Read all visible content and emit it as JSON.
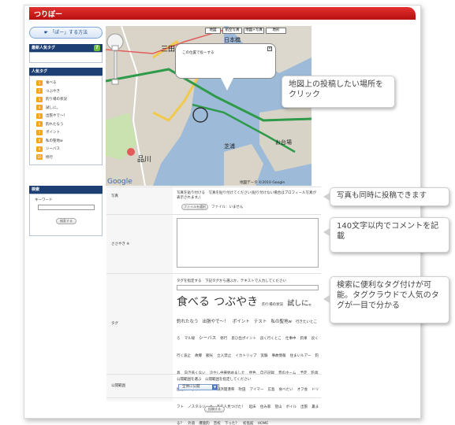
{
  "header": {
    "title": "つりぽー"
  },
  "sidebar": {
    "howto_label": "「ぽー」する方法",
    "popular_fish_title": "最新人気タグ",
    "popular_tags_title": "人気タグ",
    "tags": [
      {
        "num": "1",
        "label": "食べる"
      },
      {
        "num": "2",
        "label": "つぶやき"
      },
      {
        "num": "3",
        "label": "釣り場の状況"
      },
      {
        "num": "4",
        "label": "試しに。"
      },
      {
        "num": "5",
        "label": "出張やで～！"
      },
      {
        "num": "6",
        "label": "釣れたなう"
      },
      {
        "num": "7",
        "label": "ポイント"
      },
      {
        "num": "8",
        "label": "私の聖地w"
      },
      {
        "num": "9",
        "label": "シーバス"
      },
      {
        "num": "10",
        "label": "修行"
      }
    ],
    "search_title": "検索",
    "keyword_label": "キーワード",
    "search_button": "検索する"
  },
  "map": {
    "types": [
      "地図",
      "航空写真",
      "地図+写真",
      "地形"
    ],
    "bubble_text": "この位置で投ーする",
    "labels": [
      "三田",
      "品川",
      "芝浦",
      "日本橋",
      "お台場"
    ],
    "footer": "地図データ ©2010 Google"
  },
  "form": {
    "photo_label": "写真",
    "photo_note": "写真を貼り付ける　写真を貼り付けてください(貼り付けない場合はプロフィール写真が表示されます。)",
    "photo_button": "ファイルを選択",
    "photo_status": "ファイル：いません",
    "comment_label": "ささやき ※",
    "tag_label": "タグ",
    "tag_hint": "タグを指定する　下記タグから選ぶか、テキストで入力してください",
    "cloud": [
      {
        "t": "食べる",
        "s": "big"
      },
      {
        "t": "つぶやき",
        "s": "big"
      },
      {
        "t": "釣り場の状況",
        "s": "xs"
      },
      {
        "t": "試しに。",
        "s": "med"
      },
      {
        "t": "釣れたなう",
        "s": "s"
      },
      {
        "t": "出張やで～！",
        "s": "s"
      },
      {
        "t": "ポイント",
        "s": "s"
      },
      {
        "t": "テスト",
        "s": "s"
      },
      {
        "t": "私の聖地w",
        "s": "s"
      },
      {
        "t": "行きたいところ",
        "s": "xs"
      },
      {
        "t": "マル秘",
        "s": "xs"
      },
      {
        "t": "シーバス",
        "s": "s"
      },
      {
        "t": "修行",
        "s": "xs"
      },
      {
        "t": "思ひ出ポイント",
        "s": "xs"
      },
      {
        "t": "良く行くとこ",
        "s": "xs"
      },
      {
        "t": "仕事中",
        "s": "xs"
      },
      {
        "t": "釣果",
        "s": "xs"
      },
      {
        "t": "良く行く波止",
        "s": "xs"
      },
      {
        "t": "故郷",
        "s": "xs"
      },
      {
        "t": "観光",
        "s": "xs"
      },
      {
        "t": "立入禁止",
        "s": "xs"
      },
      {
        "t": "イカトリップ",
        "s": "xs"
      },
      {
        "t": "実験",
        "s": "xs"
      },
      {
        "t": "事故情報",
        "s": "xs"
      },
      {
        "t": "住まいルアー",
        "s": "xs"
      },
      {
        "t": "釣具",
        "s": "xs"
      },
      {
        "t": "向き低くない",
        "s": "xs"
      },
      {
        "t": "冷やし中華始めました",
        "s": "xs"
      },
      {
        "t": "昼色",
        "s": "xs"
      },
      {
        "t": "自己記録",
        "s": "xs"
      },
      {
        "t": "昔のホーム",
        "s": "xs"
      },
      {
        "t": "予定",
        "s": "xs"
      },
      {
        "t": "釣具屋巡り",
        "s": "xs"
      },
      {
        "t": "ホタル",
        "s": "xs"
      },
      {
        "t": "test",
        "s": "xs"
      },
      {
        "t": "横浜開港祭",
        "s": "xs"
      },
      {
        "t": "吹田",
        "s": "xs"
      },
      {
        "t": "アイマー",
        "s": "xs"
      },
      {
        "t": "広島",
        "s": "xs"
      },
      {
        "t": "食べたい",
        "s": "xs"
      },
      {
        "t": "オフ会",
        "s": "xs"
      },
      {
        "t": "ドリフト",
        "s": "xs"
      },
      {
        "t": "ノスタルジック",
        "s": "xs"
      },
      {
        "t": "有名人見つけた！",
        "s": "xs"
      },
      {
        "t": "起床",
        "s": "xs"
      },
      {
        "t": "住み家",
        "s": "xs"
      },
      {
        "t": "登山",
        "s": "xs"
      },
      {
        "t": "ボイル",
        "s": "xs"
      },
      {
        "t": "出張",
        "s": "xs"
      },
      {
        "t": "裏まる？",
        "s": "xs"
      },
      {
        "t": "外道",
        "s": "xs"
      },
      {
        "t": "爆発釣",
        "s": "xs"
      },
      {
        "t": "音校",
        "s": "xs"
      },
      {
        "t": "下った？",
        "s": "xs"
      },
      {
        "t": "初島館",
        "s": "xs"
      },
      {
        "t": "HOME",
        "s": "xs"
      }
    ],
    "visibility_label": "公開範囲",
    "visibility_hint": "公開範囲を選ぶ　公開範囲を指定してください",
    "visibility_value": "全体に公開",
    "submit_button": "投稿する"
  },
  "callouts": {
    "map": "地図上の投稿したい場所をクリック",
    "photo": "写真も同時に投稿できます",
    "comment": "140文字以内でコメントを記載",
    "tags": "検索に便利なタグ付けが可能。タグクラウドで人気のタグが一目で分かる"
  },
  "colors": {
    "header": "#c8161d",
    "sidebar_head": "#1d3f73",
    "tag_num": "#f3a51b",
    "map_water": "#97b6d6"
  }
}
